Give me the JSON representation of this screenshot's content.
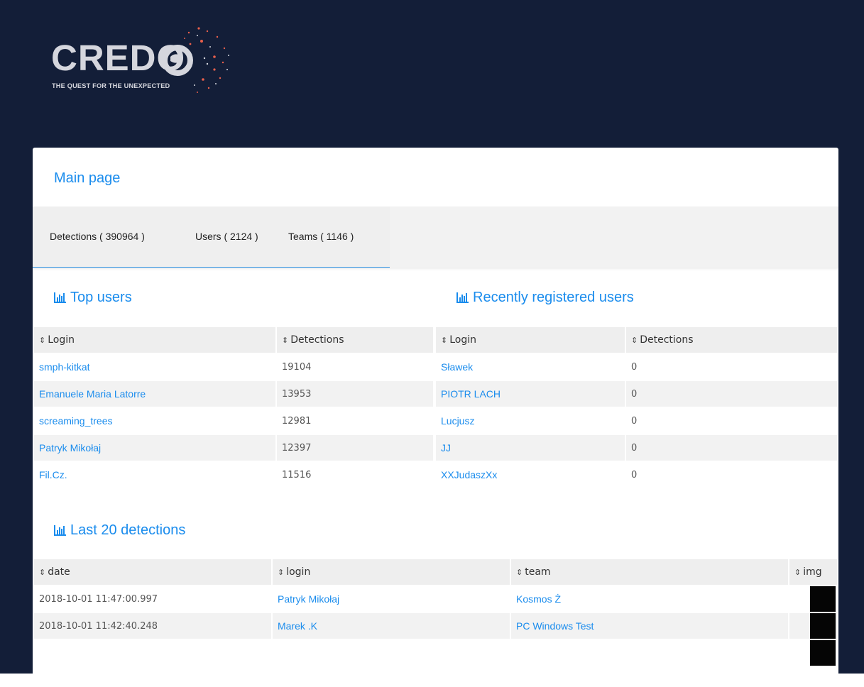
{
  "brand": {
    "logo_text": "CREDO",
    "tagline": "THE QUEST FOR THE UNEXPECTED"
  },
  "page": {
    "title": "Main page"
  },
  "tabs": [
    {
      "label": "Detections ( 390964 )"
    },
    {
      "label": "Users ( 2124 )"
    },
    {
      "label": "Teams ( 1146 )"
    }
  ],
  "top_users": {
    "title": "Top users",
    "headers": [
      "Login",
      "Detections"
    ],
    "rows": [
      {
        "login": "smph-kitkat",
        "detections": "19104"
      },
      {
        "login": "Emanuele Maria Latorre",
        "detections": "13953"
      },
      {
        "login": "screaming_trees",
        "detections": "12981"
      },
      {
        "login": "Patryk Mikołaj",
        "detections": "12397"
      },
      {
        "login": "Fil.Cz.",
        "detections": "11516"
      }
    ]
  },
  "recent_users": {
    "title": "Recently registered users",
    "headers": [
      "Login",
      "Detections"
    ],
    "rows": [
      {
        "login": "Sławek",
        "detections": "0"
      },
      {
        "login": "PIOTR LACH",
        "detections": "0"
      },
      {
        "login": "Lucjusz",
        "detections": "0"
      },
      {
        "login": "JJ",
        "detections": "0"
      },
      {
        "login": "XXJudaszXx",
        "detections": "0"
      }
    ]
  },
  "last_detections": {
    "title": "Last 20 detections",
    "headers": [
      "date",
      "login",
      "team",
      "img"
    ],
    "rows": [
      {
        "date": "2018-10-01 11:47:00.997",
        "login": "Patryk Mikołaj",
        "team": "Kosmos Ż"
      },
      {
        "date": "2018-10-01 11:42:40.248",
        "login": "Marek .K",
        "team": "PC Windows Test"
      },
      {
        "date": "",
        "login": "",
        "team": ""
      }
    ]
  },
  "icons": {
    "sort": "sort-icon",
    "chart": "bar-chart-icon"
  },
  "colors": {
    "header_bg": "#131e38",
    "link": "#1a8ced",
    "tab_active_border": "#2b8fe0",
    "logo_accent": "#e8604c"
  }
}
